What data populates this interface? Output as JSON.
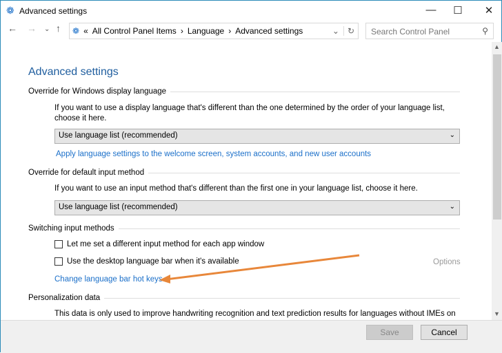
{
  "window": {
    "title": "Advanced settings",
    "minimize": "—",
    "maximize": "☐",
    "close": "✕"
  },
  "nav": {
    "back": "←",
    "forward": "→",
    "recent": "⌄",
    "up": "↑",
    "refresh": "↻",
    "dropdown": "⌄"
  },
  "breadcrumb": {
    "overflow": "«",
    "items": [
      "All Control Panel Items",
      "Language",
      "Advanced settings"
    ],
    "sep": "›"
  },
  "search": {
    "placeholder": "Search Control Panel",
    "icon": "⚲"
  },
  "page": {
    "title": "Advanced settings",
    "display_lang": {
      "header": "Override for Windows display language",
      "desc": "If you want to use a display language that's different than the one determined by the order of your language list, choose it here.",
      "select": "Use language list (recommended)",
      "link": "Apply language settings to the welcome screen, system accounts, and new user accounts"
    },
    "input_method": {
      "header": "Override for default input method",
      "desc": "If you want to use an input method that's different than the first one in your language list, choose it here.",
      "select": "Use language list (recommended)"
    },
    "switching": {
      "header": "Switching input methods",
      "cb1": "Let me set a different input method for each app window",
      "cb2": "Use the desktop language bar when it's available",
      "options": "Options",
      "link": "Change language bar hot keys"
    },
    "personalization": {
      "header": "Personalization data",
      "desc": "This data is only used to improve handwriting recognition and text prediction results for languages without IMEs on this"
    }
  },
  "footer": {
    "save": "Save",
    "cancel": "Cancel"
  },
  "colors": {
    "arrow": "#e8873a",
    "link": "#1a6fc9"
  }
}
